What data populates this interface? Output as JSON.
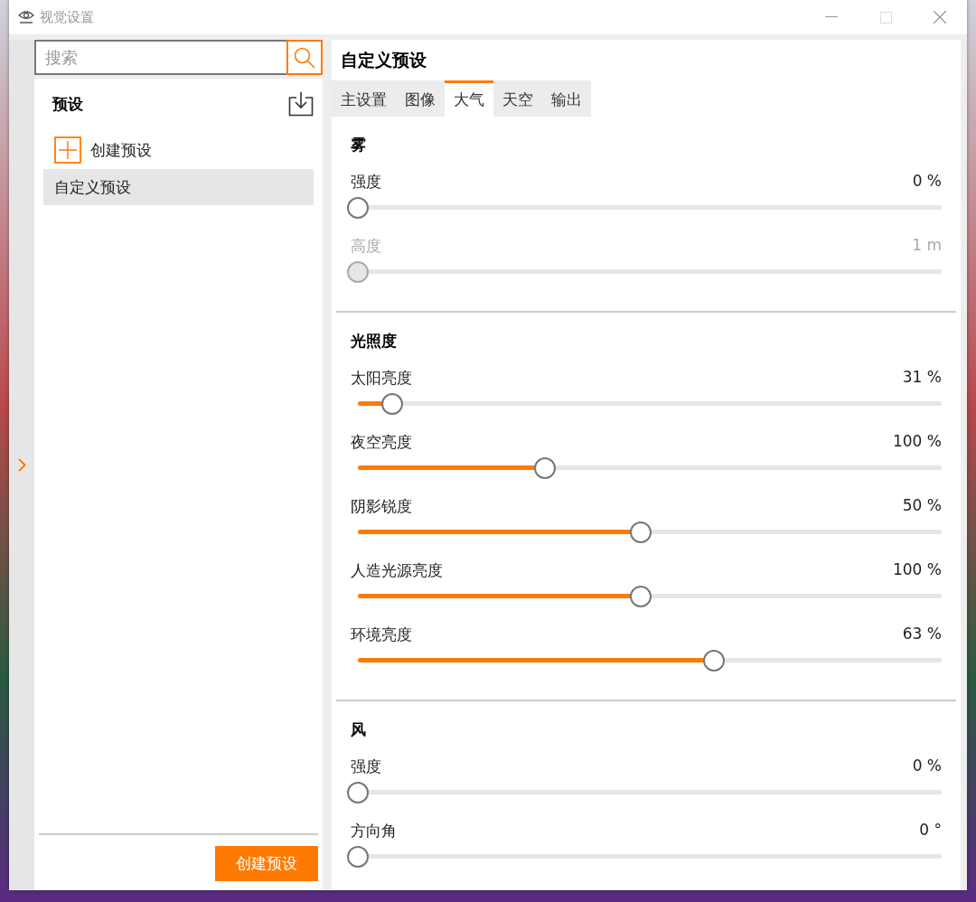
{
  "window": {
    "title": "视觉设置",
    "maximize_disabled": true
  },
  "search": {
    "placeholder": "搜索"
  },
  "presets": {
    "title": "预设",
    "create_label": "创建预设",
    "items": [
      {
        "label": "自定义预设",
        "selected": true
      }
    ],
    "create_button": "创建预设"
  },
  "panel": {
    "title": "自定义预设"
  },
  "tabs": [
    {
      "label": "主设置",
      "selected": false
    },
    {
      "label": "图像",
      "selected": false
    },
    {
      "label": "大气",
      "selected": true
    },
    {
      "label": "天空",
      "selected": false
    },
    {
      "label": "输出",
      "selected": false
    }
  ],
  "sections": [
    {
      "title": "雾",
      "sliders": [
        {
          "label": "强度",
          "value": "0 %",
          "level": 0,
          "disabled": false
        },
        {
          "label": "高度",
          "value": "1 m",
          "level": 0,
          "disabled": true
        }
      ]
    },
    {
      "title": "光照度",
      "sliders": [
        {
          "label": "太阳亮度",
          "value": "31 %",
          "level": 0.06,
          "disabled": false
        },
        {
          "label": "夜空亮度",
          "value": "100 %",
          "level": 0.33,
          "disabled": false
        },
        {
          "label": "阴影锐度",
          "value": "50 %",
          "level": 0.5,
          "disabled": false
        },
        {
          "label": "人造光源亮度",
          "value": "100 %",
          "level": 0.5,
          "disabled": false
        },
        {
          "label": "环境亮度",
          "value": "63 %",
          "level": 0.63,
          "disabled": false
        }
      ]
    },
    {
      "title": "风",
      "sliders": [
        {
          "label": "强度",
          "value": "0 %",
          "level": 0,
          "disabled": false
        },
        {
          "label": "方向角",
          "value": "0 °",
          "level": 0,
          "disabled": false
        }
      ]
    }
  ]
}
